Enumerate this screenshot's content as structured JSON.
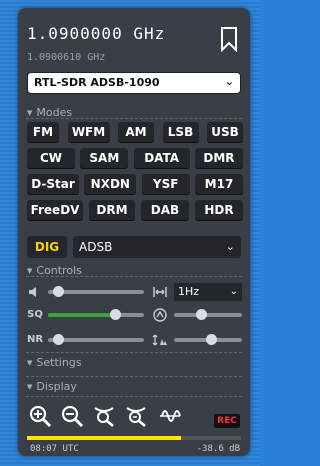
{
  "frequency": {
    "main": "1.0900000 GHz",
    "sub": "1.0900610 GHz"
  },
  "device": {
    "selected": "RTL-SDR ADSB-1090"
  },
  "sections": {
    "modes": "Modes",
    "controls": "Controls",
    "settings": "Settings",
    "display": "Display"
  },
  "modes": {
    "rows": [
      [
        "FM",
        "WFM",
        "AM",
        "LSB",
        "USB"
      ],
      [
        "CW",
        "SAM",
        "DATA",
        "DMR"
      ],
      [
        "D-Star",
        "NXDN",
        "YSF",
        "M17"
      ],
      [
        "FreeDV",
        "DRM",
        "DAB",
        "HDR"
      ]
    ]
  },
  "digital": {
    "label": "DIG",
    "decoder": "ADSB"
  },
  "controls": {
    "step": "1Hz",
    "labels": {
      "squelch": "SQ",
      "noise_reduction": "NR"
    },
    "levels": {
      "volume": 0.1,
      "squelch": 0.7,
      "nr": 0.1,
      "bandwidth_r1": 0.4,
      "bandwidth_r2": 0.55
    }
  },
  "footer": {
    "rec": "REC",
    "time": "08:07 UTC",
    "level": "-38.6 dB",
    "meter_fraction": 0.72
  },
  "icons": [
    "chevron-down-icon",
    "bookmark-icon",
    "volume-icon",
    "width-icon",
    "agc-icon",
    "squeeze-icon",
    "zoom-in-icon",
    "zoom-out-icon",
    "sat-icon",
    "waveform-icon"
  ],
  "colors": {
    "panel": "#3a3f47",
    "accent_yellow": "#ffd200",
    "rec": "#ff3030",
    "squelch_green": "#3aa33a"
  }
}
